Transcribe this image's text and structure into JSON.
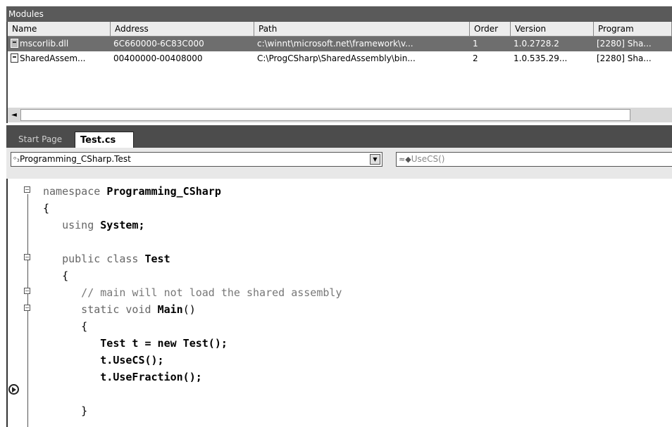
{
  "modules": {
    "title": "Modules",
    "columns": [
      "Name",
      "Address",
      "Path",
      "Order",
      "Version",
      "Program"
    ],
    "rows": [
      {
        "name": "mscorlib.dll",
        "address": "6C660000-6C83C000",
        "path": "c:\\winnt\\microsoft.net\\framework\\v...",
        "order": "1",
        "version": "1.0.2728.2",
        "program": "[2280] Sha...",
        "selected": true
      },
      {
        "name": "SharedAssem...",
        "address": "00400000-00408000",
        "path": "C:\\ProgCSharp\\SharedAssembly\\bin...",
        "order": "2",
        "version": "1.0.535.29...",
        "program": "[2280] Sha...",
        "selected": false
      }
    ],
    "scroll_left_arrow": "◄"
  },
  "editor": {
    "tabs": [
      {
        "label": "Start Page",
        "active": false
      },
      {
        "label": "Test.cs",
        "active": true
      }
    ],
    "class_dropdown": {
      "glyph": "ᵒ₃",
      "value": "Programming_CSharp.Test",
      "arrow": "▼"
    },
    "member_dropdown": {
      "glyph": "≈◆",
      "value": "UseCS()"
    },
    "code": [
      {
        "parts": [
          {
            "t": "namespace ",
            "c": "kw"
          },
          {
            "t": "Programming_CSharp",
            "c": "bold"
          }
        ]
      },
      {
        "parts": [
          {
            "t": "{",
            "c": ""
          }
        ]
      },
      {
        "parts": [
          {
            "t": "   using ",
            "c": "kw"
          },
          {
            "t": "System;",
            "c": "bold"
          }
        ]
      },
      {
        "parts": [
          {
            "t": "",
            "c": ""
          }
        ]
      },
      {
        "parts": [
          {
            "t": "   public class ",
            "c": "kw"
          },
          {
            "t": "Test",
            "c": "bold"
          }
        ]
      },
      {
        "parts": [
          {
            "t": "   {",
            "c": ""
          }
        ]
      },
      {
        "parts": [
          {
            "t": "      // main will not load the shared assembly",
            "c": "cm"
          }
        ]
      },
      {
        "parts": [
          {
            "t": "      static void ",
            "c": "kw"
          },
          {
            "t": "Main",
            "c": "bold"
          },
          {
            "t": "()",
            "c": ""
          }
        ]
      },
      {
        "parts": [
          {
            "t": "      {",
            "c": ""
          }
        ]
      },
      {
        "parts": [
          {
            "t": "         Test t = new Test();",
            "c": "bold"
          }
        ]
      },
      {
        "parts": [
          {
            "t": "         t.UseCS();",
            "c": "bold"
          }
        ]
      },
      {
        "parts": [
          {
            "t": "         t.UseFraction();",
            "c": "bold"
          }
        ]
      },
      {
        "parts": [
          {
            "t": "",
            "c": ""
          }
        ]
      },
      {
        "parts": [
          {
            "t": "      }",
            "c": ""
          }
        ]
      }
    ]
  }
}
